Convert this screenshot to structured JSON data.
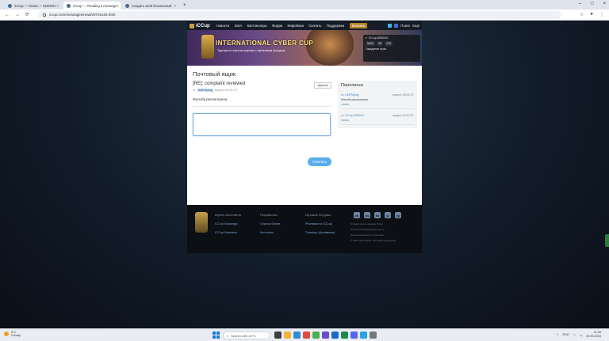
{
  "browser": {
    "tabs": [
      {
        "title": "iCCup — Поиск — 9180041",
        "active": false
      },
      {
        "title": "iCCup — Reading a message",
        "active": true
      },
      {
        "title": "Создать свой безопасный",
        "active": false
      }
    ],
    "url": "iccup.com/messages/read/20791434.html"
  },
  "site": {
    "logo": "iCCup",
    "nav": [
      "Новости",
      "DotA",
      "Кастом игры",
      "Форум",
      "Инфобаза",
      "Скачать",
      "Поддержка"
    ],
    "shop": "Магазин",
    "search": "Поиск",
    "user_menu": "Ещё"
  },
  "banner": {
    "title": "INTERNATIONAL CYBER CUP",
    "subtitle": "Турнир по кастом картам с призовым фондом"
  },
  "userpanel": {
    "name": "iCCup-8052001",
    "stats": [
      "5000",
      "99",
      "125"
    ],
    "note": "Ожидание игры"
  },
  "content": {
    "page_title": "Почтовый ящик",
    "message": {
      "subject": "[RE]: complaint reviewed",
      "delete": "Удалить",
      "from_prefix": "от",
      "author": "DMFSpring",
      "date": "вчера в 09:03 GT",
      "body": "Жалоба рассмотрена"
    },
    "reply_placeholder": "",
    "send": "Отвечать",
    "sidebar": {
      "title": "Переписка",
      "items": [
        {
          "from": "от: DMFSpring",
          "date": "вчера в 09:03 GT",
          "text": "Жалоба рассмотрена",
          "link": "читать"
        },
        {
          "from": "от: iCCup-8052001",
          "date": "среда в 15:10 GT",
          "text": "",
          "link": "читать"
        }
      ]
    }
  },
  "footer": {
    "col1": [
      "Играть бесплатно",
      "iCCup Команда",
      "iCCup Магазин"
    ],
    "col2": [
      "Разработка",
      "Список банов",
      "Контакты"
    ],
    "col3": [
      "Игровые Форумы",
      "Реклама на iCCup",
      "Помощь (Архивная)"
    ],
    "socials": [
      "vk",
      "ds",
      "tw",
      "yt",
      "tg"
    ],
    "small": [
      "Условия использования iCCup",
      "Политика конфиденциальности",
      "Пользовательское соглашение",
      "© 2006–2023 iCCup. Все права защищены."
    ]
  },
  "taskbar": {
    "weather_temp": "5°C",
    "weather_desc": "Cloudy",
    "search": "Search web & PC",
    "lang": "ENG",
    "time": "11:06",
    "date": "19.09.2023"
  }
}
